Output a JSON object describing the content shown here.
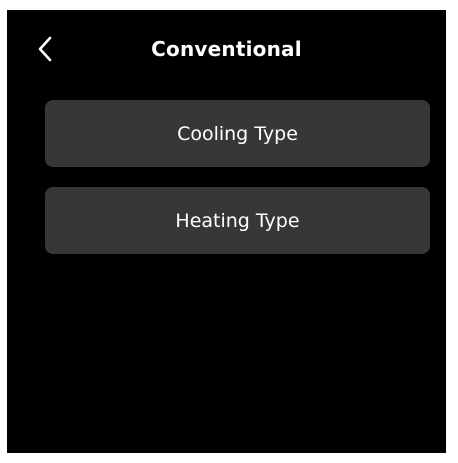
{
  "header": {
    "title": "Conventional",
    "back_icon": "chevron-left-icon"
  },
  "menu": {
    "items": [
      {
        "label": "Cooling Type"
      },
      {
        "label": "Heating Type"
      }
    ]
  },
  "colors": {
    "background": "#000000",
    "button": "#373737",
    "text": "#ffffff"
  }
}
